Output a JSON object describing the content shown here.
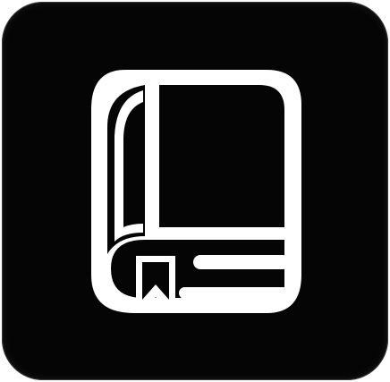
{
  "app_icon": {
    "icon": "book-icon",
    "background_color": "#050505",
    "glyph_color": "#ffffff"
  }
}
